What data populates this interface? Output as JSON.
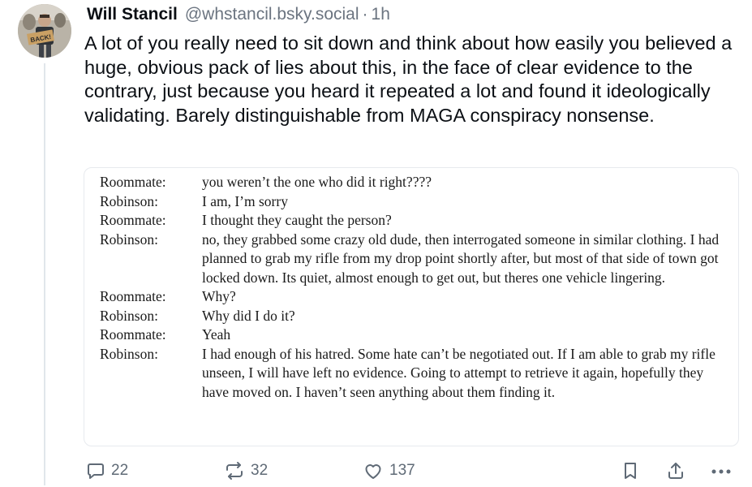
{
  "post": {
    "author_name": "Will Stancil",
    "author_handle": "@whstancil.bsky.social",
    "separator": "·",
    "time": "1h",
    "avatar_sign_text": "BACK!",
    "text": "A lot of you really need to sit down and think about how easily you believed a huge, obvious pack of lies about this, in the face of clear evidence to the contrary, just because you heard it repeated a lot and found it ideologically validating. Barely distinguishable from MAGA conspiracy nonsense."
  },
  "embed": {
    "lines": [
      {
        "speaker": "Roommate:",
        "text": "you weren’t the one who did it right????"
      },
      {
        "speaker": "Robinson:",
        "text": "I am, I’m sorry"
      },
      {
        "speaker": "Roommate:",
        "text": "I thought they caught the person?"
      },
      {
        "speaker": "Robinson:",
        "text": "no, they grabbed some crazy old dude, then interrogated someone in similar clothing. I had planned to grab my rifle from my drop point shortly after, but most of that side of town got locked down. Its quiet, almost enough to get out, but theres one vehicle lingering."
      },
      {
        "speaker": "Roommate:",
        "text": "Why?"
      },
      {
        "speaker": "Robinson:",
        "text": "Why did I do it?"
      },
      {
        "speaker": "Roommate:",
        "text": "Yeah"
      },
      {
        "speaker": "Robinson:",
        "text": "I had enough of his hatred. Some hate can’t be negotiated out. If I am able to grab my rifle unseen, I will have left no evidence. Going to attempt to retrieve it again, hopefully they have moved on. I haven’t seen anything about them finding it."
      }
    ]
  },
  "actions": {
    "replies": "22",
    "reposts": "32",
    "likes": "137"
  },
  "icons": {
    "reply": "reply-icon",
    "repost": "repost-icon",
    "like": "heart-icon",
    "bookmark": "bookmark-icon",
    "share": "share-icon",
    "more": "more-icon"
  },
  "colors": {
    "text": "#0b0f14",
    "muted": "#6b7480",
    "border": "#e7eaee"
  }
}
